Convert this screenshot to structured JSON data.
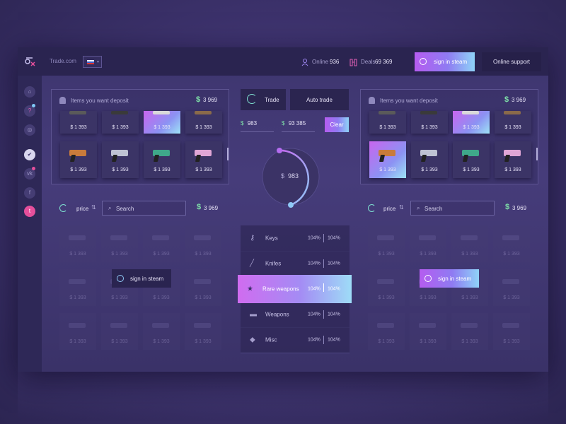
{
  "topbar": {
    "site_name": "Trade.com",
    "online_label": "Online",
    "online_count": "936",
    "deals_label": "Deals",
    "deals_count": "69 369",
    "sign_in_label": "sign in steam",
    "support_label": "Online support"
  },
  "sidebar": {
    "icons": [
      "home-icon",
      "help-icon",
      "target-icon",
      "steam-check-icon",
      "vk-icon",
      "facebook-icon",
      "twitter-icon"
    ]
  },
  "left_inventory": {
    "title": "Items you want deposit",
    "total": "3 969",
    "items": [
      {
        "price": "$ 1 393",
        "selected": false
      },
      {
        "price": "$ 1 393",
        "selected": false
      },
      {
        "price": "$ 1 393",
        "selected": true
      },
      {
        "price": "$ 1 393",
        "selected": false
      },
      {
        "price": "$ 1 393",
        "selected": false
      },
      {
        "price": "$ 1 393",
        "selected": false
      },
      {
        "price": "$ 1 393",
        "selected": false
      },
      {
        "price": "$ 1 393",
        "selected": false
      }
    ]
  },
  "right_inventory": {
    "title": "Items you want deposit",
    "total": "3 969",
    "items": [
      {
        "price": "$ 1 393",
        "selected": false
      },
      {
        "price": "$ 1 393",
        "selected": false
      },
      {
        "price": "$ 1 393",
        "selected": true
      },
      {
        "price": "$ 1 393",
        "selected": false
      },
      {
        "price": "$ 1 393",
        "selected": true
      },
      {
        "price": "$ 1 393",
        "selected": false
      },
      {
        "price": "$ 1 393",
        "selected": false
      },
      {
        "price": "$ 1 393",
        "selected": false
      }
    ]
  },
  "trade": {
    "trade_label": "Trade",
    "auto_trade_label": "Auto trade",
    "input_left": "983",
    "input_right": "93 385",
    "clear_label": "Clear",
    "dial_value": "983",
    "currency": "$"
  },
  "left_market": {
    "sort_label": "price",
    "search_placeholder": "Search",
    "total": "3 969",
    "sign_in_label": "sign in steam",
    "ghost_price": "$ 1 393"
  },
  "right_market": {
    "sort_label": "price",
    "search_placeholder": "Search",
    "total": "3 969",
    "sign_in_label": "sign in steam",
    "ghost_price": "$ 1 393"
  },
  "categories": [
    {
      "name": "Keys",
      "v1": "104%",
      "v2": "104%",
      "selected": false,
      "icon": "key-icon"
    },
    {
      "name": "Knifes",
      "v1": "104%",
      "v2": "104%",
      "selected": false,
      "icon": "knife-icon"
    },
    {
      "name": "Rare weapons",
      "v1": "104%",
      "v2": "104%",
      "selected": true,
      "icon": "star-icon"
    },
    {
      "name": "Weapons",
      "v1": "104%",
      "v2": "104%",
      "selected": false,
      "icon": "gun-icon"
    },
    {
      "name": "Misc",
      "v1": "104%",
      "v2": "104%",
      "selected": false,
      "icon": "misc-icon"
    }
  ],
  "colors": {
    "accent_pink": "#c865ee",
    "accent_blue": "#9ee3f6",
    "price_green": "#7ee0a8",
    "background": "#3d356e"
  }
}
